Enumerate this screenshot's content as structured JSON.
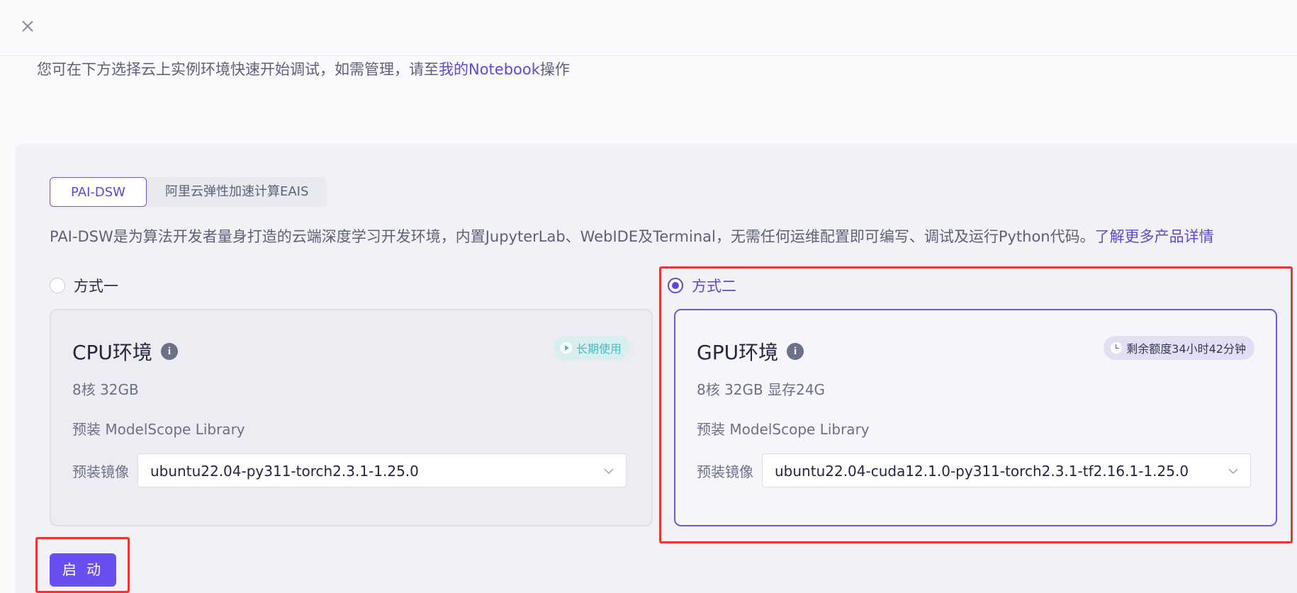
{
  "header": {
    "hint_prefix": "您可在下方选择云上实例环境快速开始调试，如需管理，请至",
    "hint_link": "我的Notebook",
    "hint_suffix": "操作"
  },
  "tabs": [
    {
      "label": "PAI-DSW",
      "active": true
    },
    {
      "label": "阿里云弹性加速计算EAIS",
      "active": false
    }
  ],
  "description": {
    "text": "PAI-DSW是为算法开发者量身打造的云端深度学习开发环境，内置JupyterLab、WebIDE及Terminal，无需任何运维配置即可编写、调试及运行Python代码。",
    "link": "了解更多产品详情"
  },
  "options": [
    {
      "radio_label": "方式一",
      "selected": false,
      "title": "CPU环境",
      "badge": "长期使用",
      "badge_icon": "play-icon",
      "spec": "8核 32GB",
      "library": "预装 ModelScope Library",
      "image_label": "预装镜像",
      "image_value": "ubuntu22.04-py311-torch2.3.1-1.25.0"
    },
    {
      "radio_label": "方式二",
      "selected": true,
      "title": "GPU环境",
      "badge": "剩余额度34小时42分钟",
      "badge_icon": "clock-icon",
      "spec": "8核 32GB 显存24G",
      "library": "预装 ModelScope Library",
      "image_label": "预装镜像",
      "image_value": "ubuntu22.04-cuda12.1.0-py311-torch2.3.1-tf2.16.1-1.25.0"
    }
  ],
  "start_button": "启 动",
  "colors": {
    "accent": "#5b4ad9",
    "button": "#6b4ef2",
    "highlight": "#ee3535",
    "teal_badge": "#3cc1c1"
  }
}
